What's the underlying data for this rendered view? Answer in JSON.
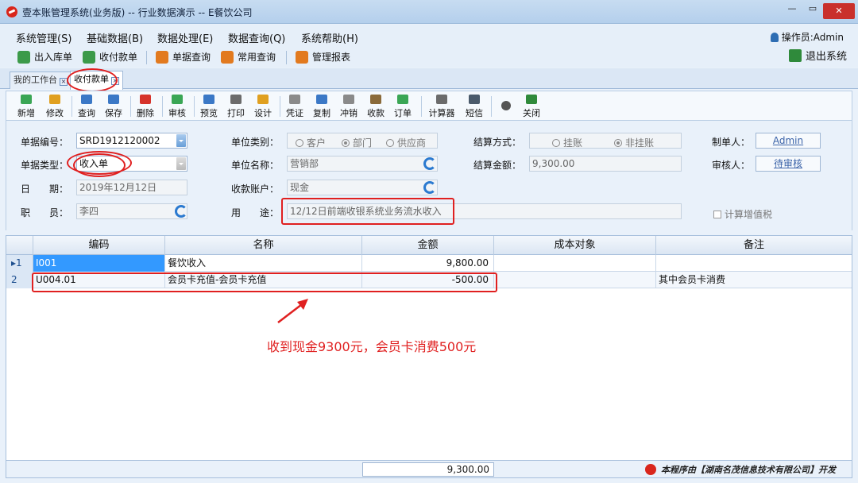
{
  "window": {
    "title": "壹本账管理系统(业务版) -- 行业数据演示 -- E餐饮公司",
    "min_glyph": "—",
    "max_glyph": "▭",
    "close_glyph": "✕"
  },
  "menu": {
    "items": [
      "系统管理(S)",
      "基础数据(B)",
      "数据处理(E)",
      "数据查询(Q)",
      "系统帮助(H)"
    ],
    "operator": "操作员:Admin"
  },
  "main_toolbar": {
    "buttons": [
      {
        "label": "出入库单",
        "icon": "stock-doc-icon",
        "color": "#3c9a4a"
      },
      {
        "label": "收付款单",
        "icon": "payment-doc-icon",
        "color": "#3c9a4a"
      },
      {
        "label": "单据查询",
        "icon": "doc-query-icon",
        "color": "#e27a1f"
      },
      {
        "label": "常用查询",
        "icon": "chart-query-icon",
        "color": "#e27a1f"
      },
      {
        "label": "管理报表",
        "icon": "report-icon",
        "color": "#e27a1f"
      }
    ],
    "exit_label": "退出系统"
  },
  "tabs": [
    {
      "label": "我的工作台",
      "active": false
    },
    {
      "label": "收付款单",
      "active": true
    }
  ],
  "tab_close_glyph": "×",
  "form_toolbar": {
    "buttons": [
      {
        "label": "新增",
        "name": "new",
        "color": "#3aa655"
      },
      {
        "label": "修改",
        "name": "edit",
        "color": "#e0a020"
      },
      {
        "label": "查询",
        "name": "query",
        "color": "#3b78c6"
      },
      {
        "label": "保存",
        "name": "save",
        "color": "#3b78c6"
      },
      {
        "label": "删除",
        "name": "delete",
        "color": "#d6332b"
      },
      {
        "label": "审核",
        "name": "audit",
        "color": "#3aa655"
      },
      {
        "label": "预览",
        "name": "preview",
        "color": "#3b78c6"
      },
      {
        "label": "打印",
        "name": "print",
        "color": "#6b6b6b"
      },
      {
        "label": "设计",
        "name": "design",
        "color": "#e0a020"
      },
      {
        "label": "凭证",
        "name": "voucher",
        "color": "#8a8a8a"
      },
      {
        "label": "复制",
        "name": "copy",
        "color": "#3b78c6"
      },
      {
        "label": "冲销",
        "name": "reverse",
        "color": "#8a8a8a"
      },
      {
        "label": "收款",
        "name": "collect",
        "color": "#8a6a3a"
      },
      {
        "label": "订单",
        "name": "order",
        "color": "#3aa655"
      },
      {
        "label": "计算器",
        "name": "calculator",
        "color": "#6b6b6b"
      },
      {
        "label": "短信",
        "name": "sms",
        "color": "#4a5a6b"
      },
      {
        "label": "关闭",
        "name": "close",
        "color": "#2f8a3b"
      }
    ]
  },
  "form": {
    "doc_no_label": "单据编号：",
    "doc_no": "SRD1912120002",
    "doc_type_label": "单据类型：",
    "doc_type": "收入单",
    "date_label": "日　　期：",
    "date": "2019年12月12日",
    "staff_label": "职　　员：",
    "staff": "李四",
    "unit_type_label": "单位类别：",
    "unit_type_options": [
      {
        "label": "客户",
        "checked": false
      },
      {
        "label": "部门",
        "checked": true
      },
      {
        "label": "供应商",
        "checked": false
      }
    ],
    "unit_name_label": "单位名称：",
    "unit_name": "营销部",
    "account_label": "收款账户：",
    "account": "现金",
    "purpose_label": "用　　途：",
    "purpose": "12/12日前端收银系统业务流水收入",
    "settle_label": "结算方式：",
    "settle_options": [
      {
        "label": "挂账",
        "checked": false
      },
      {
        "label": "非挂账",
        "checked": true
      }
    ],
    "amount_label": "结算金额：",
    "amount": "9,300.00",
    "maker_label": "制单人：",
    "maker": "Admin",
    "auditor_label": "审核人：",
    "auditor": "待审核",
    "vat_label": "计算增值税"
  },
  "grid": {
    "columns": [
      "编码",
      "名称",
      "金额",
      "成本对象",
      "备注"
    ],
    "rows": [
      {
        "index": "1",
        "code": "I001",
        "name": "餐饮收入",
        "amount": "9,800.00",
        "cost": "",
        "note": ""
      },
      {
        "index": "2",
        "code": "U004.01",
        "name": "会员卡充值-会员卡充值",
        "amount": "-500.00",
        "cost": "",
        "note": "其中会员卡消费"
      }
    ],
    "total": "9,300.00"
  },
  "annotation": "收到现金9300元，会员卡消费500元",
  "footer_brand": "本程序由【湖南名茂信息技术有限公司】开发",
  "accent_red": "#e02020"
}
